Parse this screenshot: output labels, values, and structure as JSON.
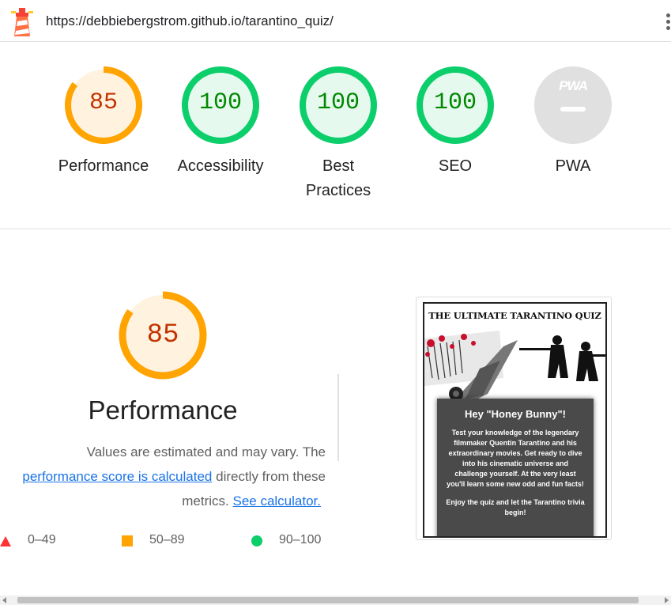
{
  "browser": {
    "url": "https://debbiebergstrom.github.io/tarantino_quiz/",
    "menu_icon": "kebab-menu-icon",
    "logo_icon": "lighthouse-icon"
  },
  "categories": [
    {
      "label": "Performance",
      "score": "85",
      "rating": "average"
    },
    {
      "label": "Accessibility",
      "score": "100",
      "rating": "pass"
    },
    {
      "label": "Best Practices",
      "score": "100",
      "rating": "pass"
    },
    {
      "label": "SEO",
      "score": "100",
      "rating": "pass"
    },
    {
      "label": "PWA",
      "score": "",
      "badge": "PWA",
      "rating": "na"
    }
  ],
  "performance": {
    "score": "85",
    "title": "Performance",
    "desc_1": "Values are estimated and may vary. The",
    "link_1": "performance score is calculated",
    "desc_2": " directly from these",
    "desc_3": "metrics. ",
    "link_2": "See calculator.",
    "legend": [
      {
        "range": "0–49",
        "icon": "red-triangle-icon"
      },
      {
        "range": "50–89",
        "icon": "orange-square-icon"
      },
      {
        "range": "90–100",
        "icon": "green-circle-icon"
      }
    ]
  },
  "thumbnail": {
    "title": "THE ULTIMATE TARANTINO QUIZ",
    "card_heading": "Hey \"Honey Bunny\"!",
    "card_text": "Test your knowledge of the legendary filmmaker Quentin Tarantino and his extraordinary movies. Get ready to dive into his cinematic universe and challenge yourself. At the very least you'll learn some new odd and fun facts!",
    "card_text_2": "Enjoy the quiz and let the Tarantino trivia begin!"
  },
  "colors": {
    "average": "#ffa400",
    "average_text": "#c33300",
    "average_bg": "#fff3e0",
    "pass": "#0cce6b",
    "pass_text": "#008800",
    "pass_bg": "#e6f9ee",
    "na": "#e0e0e0",
    "fail": "#ff3333",
    "link": "#1a73e8"
  }
}
